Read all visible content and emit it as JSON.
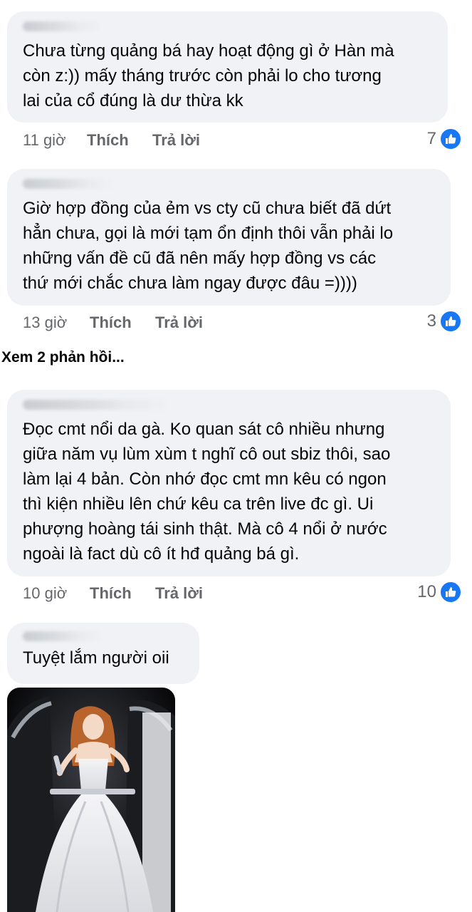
{
  "comments": [
    {
      "text": "Chưa từng quảng bá hay hoạt động gì ở Hàn mà\ncòn z:)) mấy tháng trước còn phải lo cho tương\nlai của cổ đúng là dư thừa kk",
      "time": "11 giờ",
      "like_label": "Thích",
      "reply_label": "Trả lời",
      "reactions": "7"
    },
    {
      "text": "Giờ hợp đồng của ẻm vs cty cũ chưa biết đã dứt\nhẳn chưa, gọi là mới tạm ổn định thôi vẫn phải lo\nnhững vấn đề cũ đã nên mấy hợp đồng vs các\nthứ mới chắc chưa làm ngay được đâu =))))",
      "time": "13 giờ",
      "like_label": "Thích",
      "reply_label": "Trả lời",
      "reactions": "3"
    },
    {
      "text": "Đọc cmt nổi da gà. Ko quan sát cô nhiều nhưng\ngiữa năm vụ lùm xùm t nghĩ cô out sbiz thôi, sao\nlàm lại 4 bản. Còn nhớ đọc cmt mn kêu có ngon\nthì kiện nhiều lên chứ kêu ca trên live đc gì. Ui\nphượng hoàng tái sinh thật. Mà cô 4 nổi ở nước\nngoài là fact dù cô ít hđ quảng bá gì.",
      "time": "10 giờ",
      "like_label": "Thích",
      "reply_label": "Trả lời",
      "reactions": "10"
    },
    {
      "text": "Tuyệt lắm người oii"
    }
  ],
  "view_replies": "Xem 2 phản hồi...",
  "colors": {
    "like_blue": "#1877f2",
    "bubble": "#f0f2f5",
    "meta": "#65676b"
  },
  "icons": {
    "reaction": "like-thumb-icon"
  }
}
